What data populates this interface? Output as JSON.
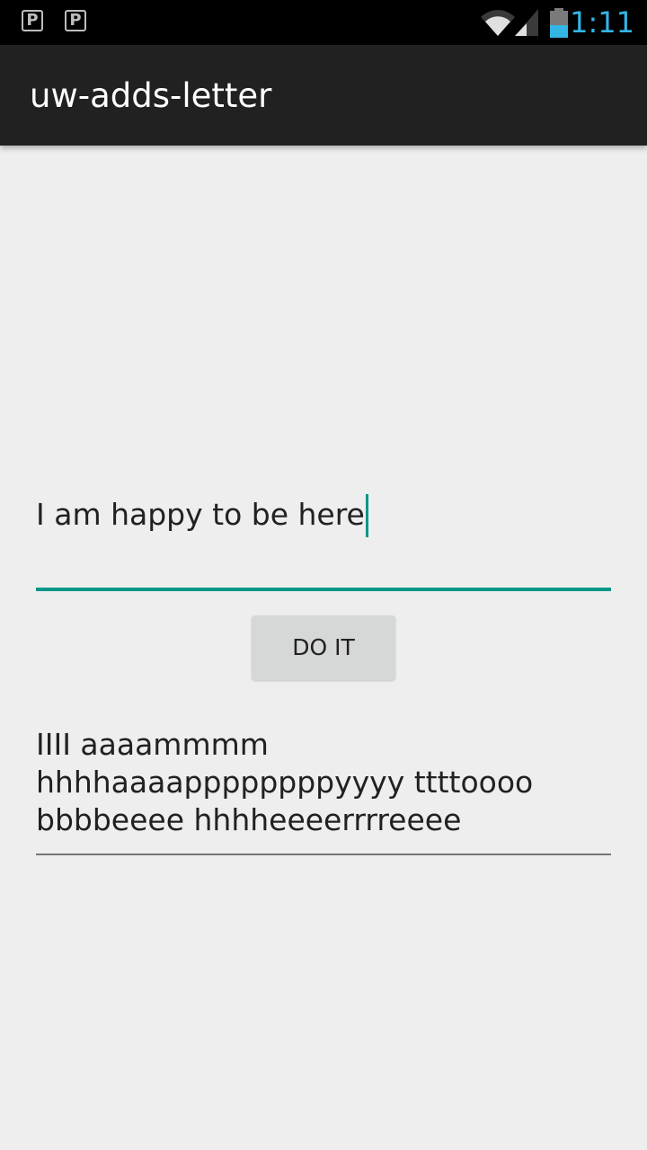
{
  "status_bar": {
    "notification_icons": [
      {
        "icon": "parking-icon",
        "glyph": "P"
      },
      {
        "icon": "parking-icon",
        "glyph": "P"
      }
    ],
    "wifi_icon": "wifi-icon",
    "signal_icon": "cell-signal-icon",
    "battery_icon": "battery-icon",
    "time": "1:11",
    "time_color": "#33b5e5"
  },
  "action_bar": {
    "title": "uw-adds-letter",
    "background": "#212121"
  },
  "input": {
    "value": "I am happy to be here",
    "accent_color": "#009688"
  },
  "button": {
    "label": "DO IT"
  },
  "output": {
    "text": "IIII aaaammmm hhhhaaaappppppppyyyy ttttoooo bbbbeeee hhhheeeerrrreeee"
  }
}
